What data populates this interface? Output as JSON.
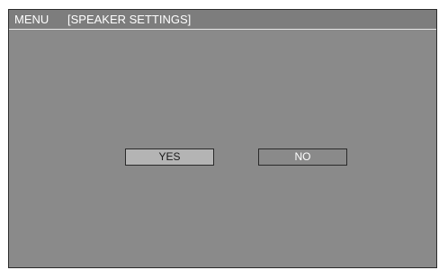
{
  "header": {
    "menu_label": "MENU",
    "section_title": "[SPEAKER SETTINGS]"
  },
  "dialog": {
    "yes_label": "YES",
    "no_label": "NO",
    "selected": "YES"
  },
  "colors": {
    "screen_background": "#8a8a8a",
    "title_bar": "#7d7d7d",
    "selected_button": "#b4b4b4",
    "text": "#ffffff"
  }
}
